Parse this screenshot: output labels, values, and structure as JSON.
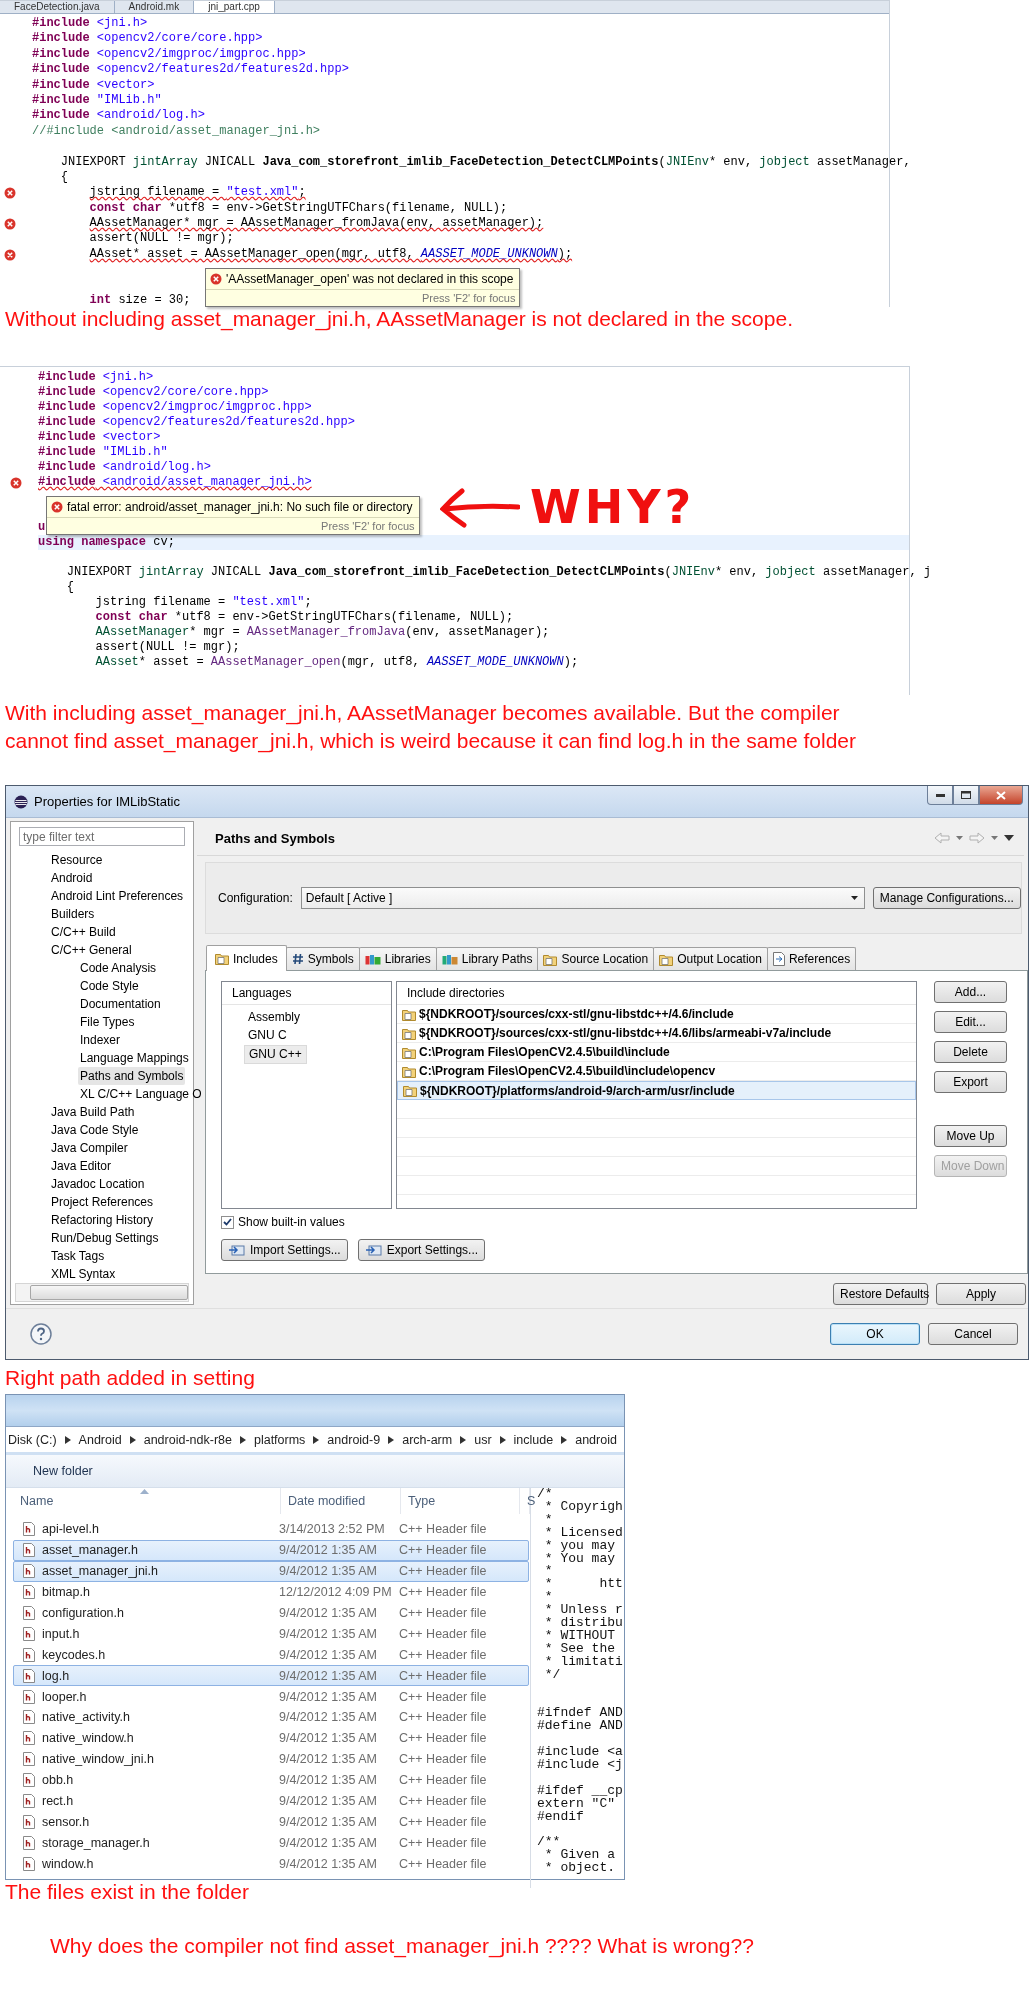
{
  "sections": [
    {
      "kind": "editor",
      "tabs": [
        {
          "label": "FaceDetection.java",
          "selected": false
        },
        {
          "label": "Android.mk",
          "selected": false
        },
        {
          "label": "jni_part.cpp",
          "selected": true
        }
      ],
      "lines": [
        {
          "kind": "code",
          "error": false,
          "current": false,
          "segs": [
            {
              "text": "#include",
              "kind": "kw"
            },
            {
              "text": " <jni.h>",
              "kind": "str"
            }
          ]
        },
        {
          "kind": "code",
          "error": false,
          "current": false,
          "segs": [
            {
              "text": "#include",
              "kind": "kw"
            },
            {
              "text": " <opencv2/core/core.hpp>",
              "kind": "str"
            }
          ]
        },
        {
          "kind": "code",
          "error": false,
          "current": false,
          "segs": [
            {
              "text": "#include",
              "kind": "kw"
            },
            {
              "text": " <opencv2/imgproc/imgproc.hpp>",
              "kind": "str"
            }
          ]
        },
        {
          "kind": "code",
          "error": false,
          "current": false,
          "segs": [
            {
              "text": "#include",
              "kind": "kw"
            },
            {
              "text": " <opencv2/features2d/features2d.hpp>",
              "kind": "str"
            }
          ]
        },
        {
          "kind": "code",
          "error": false,
          "current": false,
          "segs": [
            {
              "text": "#include",
              "kind": "kw"
            },
            {
              "text": " <vector>",
              "kind": "str"
            }
          ]
        },
        {
          "kind": "code",
          "error": false,
          "current": false,
          "segs": [
            {
              "text": "#include",
              "kind": "kw"
            },
            {
              "text": " \"IMLib.h\"",
              "kind": "str"
            }
          ]
        },
        {
          "kind": "code",
          "error": false,
          "current": false,
          "segs": [
            {
              "text": "#include",
              "kind": "kw"
            },
            {
              "text": " <android/log.h>",
              "kind": "str"
            }
          ]
        },
        {
          "kind": "code",
          "error": false,
          "current": false,
          "segs": [
            {
              "text": "//#include <android/asset_manager_jni.h>",
              "kind": "com"
            }
          ]
        },
        {
          "kind": "blank"
        },
        {
          "kind": "code",
          "error": false,
          "current": false,
          "segs": [
            {
              "text": "    JNIEXPORT ",
              "kind": "plain"
            },
            {
              "text": "jintArray",
              "kind": "type"
            },
            {
              "text": " JNICALL ",
              "kind": "plain"
            },
            {
              "text": "Java_com_storefront_imlib_FaceDetection_DetectCLMPoints",
              "kind": "fn"
            },
            {
              "text": "(",
              "kind": "plain"
            },
            {
              "text": "JNIEnv",
              "kind": "type"
            },
            {
              "text": "* env, ",
              "kind": "plain"
            },
            {
              "text": "jobject",
              "kind": "type"
            },
            {
              "text": " assetManager,",
              "kind": "plain"
            }
          ]
        },
        {
          "kind": "code",
          "error": false,
          "current": false,
          "segs": [
            {
              "text": "    {",
              "kind": "plain"
            }
          ]
        },
        {
          "kind": "code",
          "error": true,
          "current": false,
          "segs": [
            {
              "text": "        jstring filename = ",
              "kind": "plain"
            },
            {
              "text": "\"test.xml\"",
              "kind": "str"
            },
            {
              "text": ";",
              "kind": "plain"
            }
          ]
        },
        {
          "kind": "code",
          "error": false,
          "current": false,
          "segs": [
            {
              "text": "        const char",
              "kind": "kw"
            },
            {
              "text": " *utf8 = env->GetStringUTFChars(filename, NULL);",
              "kind": "plain"
            }
          ]
        },
        {
          "kind": "code",
          "error": true,
          "current": false,
          "segs": [
            {
              "text": "        AAssetManager* mgr = AAssetManager_fromJava(env, assetManager);",
              "kind": "plain"
            }
          ]
        },
        {
          "kind": "code",
          "error": false,
          "current": false,
          "segs": [
            {
              "text": "        assert(NULL != mgr);",
              "kind": "plain"
            }
          ]
        },
        {
          "kind": "code",
          "error": true,
          "current": false,
          "segs": [
            {
              "text": "        AAsset* asset = AAssetManager_open(mgr, utf8, ",
              "kind": "plain"
            },
            {
              "text": "AASSET_MODE_UNKNOWN",
              "kind": "mac"
            },
            {
              "text": ");",
              "kind": "plain"
            }
          ]
        },
        {
          "kind": "blank"
        },
        {
          "kind": "blank"
        },
        {
          "kind": "code",
          "error": false,
          "current": false,
          "segs": [
            {
              "text": "        int",
              "kind": "kw"
            },
            {
              "text": " size = 30;",
              "kind": "plain"
            }
          ]
        }
      ],
      "tooltip": {
        "message": "'AAssetManager_open' was not declared in this scope",
        "hint": "Press 'F2' for focus"
      }
    },
    {
      "kind": "caption",
      "lines": [
        "Without including asset_manager_jni.h, AAssetManager is not declared in the scope."
      ]
    },
    {
      "kind": "editor",
      "lines": [
        {
          "kind": "code",
          "error": false,
          "current": false,
          "segs": [
            {
              "text": "#include",
              "kind": "kw"
            },
            {
              "text": " <jni.h>",
              "kind": "str"
            }
          ]
        },
        {
          "kind": "code",
          "error": false,
          "current": false,
          "segs": [
            {
              "text": "#include",
              "kind": "kw"
            },
            {
              "text": " <opencv2/core/core.hpp>",
              "kind": "str"
            }
          ]
        },
        {
          "kind": "code",
          "error": false,
          "current": false,
          "segs": [
            {
              "text": "#include",
              "kind": "kw"
            },
            {
              "text": " <opencv2/imgproc/imgproc.hpp>",
              "kind": "str"
            }
          ]
        },
        {
          "kind": "code",
          "error": false,
          "current": false,
          "segs": [
            {
              "text": "#include",
              "kind": "kw"
            },
            {
              "text": " <opencv2/features2d/features2d.hpp>",
              "kind": "str"
            }
          ]
        },
        {
          "kind": "code",
          "error": false,
          "current": false,
          "segs": [
            {
              "text": "#include",
              "kind": "kw"
            },
            {
              "text": " <vector>",
              "kind": "str"
            }
          ]
        },
        {
          "kind": "code",
          "error": false,
          "current": false,
          "segs": [
            {
              "text": "#include",
              "kind": "kw"
            },
            {
              "text": " \"IMLib.h\"",
              "kind": "str"
            }
          ]
        },
        {
          "kind": "code",
          "error": false,
          "current": false,
          "segs": [
            {
              "text": "#include",
              "kind": "kw"
            },
            {
              "text": " <android/log.h>",
              "kind": "str"
            }
          ]
        },
        {
          "kind": "code",
          "error": true,
          "current": false,
          "segs": [
            {
              "text": "#include",
              "kind": "kw"
            },
            {
              "text": " <android/asset_manager_jni.h>",
              "kind": "str"
            }
          ]
        },
        {
          "kind": "blank"
        },
        {
          "kind": "blank"
        },
        {
          "kind": "code",
          "error": false,
          "current": false,
          "segs": [
            {
              "text": "u",
              "kind": "kw"
            }
          ]
        },
        {
          "kind": "code",
          "error": false,
          "current": true,
          "segs": [
            {
              "text": "using namespace",
              "kind": "kw"
            },
            {
              "text": " cv;",
              "kind": "plain"
            }
          ]
        },
        {
          "kind": "blank"
        },
        {
          "kind": "code",
          "error": false,
          "current": false,
          "segs": [
            {
              "text": "    JNIEXPORT ",
              "kind": "plain"
            },
            {
              "text": "jintArray",
              "kind": "type"
            },
            {
              "text": " JNICALL ",
              "kind": "plain"
            },
            {
              "text": "Java_com_storefront_imlib_FaceDetection_DetectCLMPoints",
              "kind": "fn"
            },
            {
              "text": "(",
              "kind": "plain"
            },
            {
              "text": "JNIEnv",
              "kind": "type"
            },
            {
              "text": "* env, ",
              "kind": "plain"
            },
            {
              "text": "jobject",
              "kind": "type"
            },
            {
              "text": " assetManager, j",
              "kind": "plain"
            }
          ]
        },
        {
          "kind": "code",
          "error": false,
          "current": false,
          "segs": [
            {
              "text": "    {",
              "kind": "plain"
            }
          ]
        },
        {
          "kind": "code",
          "error": false,
          "current": false,
          "segs": [
            {
              "text": "        jstring filename = ",
              "kind": "plain"
            },
            {
              "text": "\"test.xml\"",
              "kind": "str"
            },
            {
              "text": ";",
              "kind": "plain"
            }
          ]
        },
        {
          "kind": "code",
          "error": false,
          "current": false,
          "segs": [
            {
              "text": "        const char",
              "kind": "kw"
            },
            {
              "text": " *utf8 = env->GetStringUTFChars(filename, NULL);",
              "kind": "plain"
            }
          ]
        },
        {
          "kind": "code",
          "error": false,
          "current": false,
          "segs": [
            {
              "text": "        AAssetManager",
              "kind": "type"
            },
            {
              "text": "* mgr = ",
              "kind": "plain"
            },
            {
              "text": "AAssetManager_fromJava",
              "kind": "call"
            },
            {
              "text": "(env, assetManager);",
              "kind": "plain"
            }
          ]
        },
        {
          "kind": "code",
          "error": false,
          "current": false,
          "segs": [
            {
              "text": "        assert(NULL != mgr);",
              "kind": "plain"
            }
          ]
        },
        {
          "kind": "code",
          "error": false,
          "current": false,
          "segs": [
            {
              "text": "        AAsset",
              "kind": "type"
            },
            {
              "text": "* asset = ",
              "kind": "plain"
            },
            {
              "text": "AAssetManager_open",
              "kind": "call"
            },
            {
              "text": "(mgr, utf8, ",
              "kind": "plain"
            },
            {
              "text": "AASSET_MODE_UNKNOWN",
              "kind": "mac"
            },
            {
              "text": ");",
              "kind": "plain"
            }
          ]
        },
        {
          "kind": "blank"
        }
      ],
      "tooltip": {
        "message": "fatal error: android/asset_manager_jni.h: No such file or directory",
        "hint": "Press 'F2' for focus"
      },
      "annotation": {
        "text": "WHY?"
      }
    },
    {
      "kind": "caption",
      "lines": [
        "With including asset_manager_jni.h, AAssetManager becomes available. But the compiler",
        "cannot find asset_manager_jni.h, which is weird because it can find log.h in the same folder"
      ]
    },
    {
      "kind": "dialog",
      "title": "Properties for IMLibStatic",
      "filter": {
        "placeholder": "type filter text"
      },
      "tree": [
        {
          "label": "Resource",
          "selected": false
        },
        {
          "label": "Android",
          "selected": false
        },
        {
          "label": "Android Lint Preferences",
          "selected": false
        },
        {
          "label": "Builders",
          "selected": false
        },
        {
          "label": "C/C++ Build",
          "selected": false
        },
        {
          "label": "C/C++ General",
          "selected": false,
          "children": [
            {
              "label": "Code Analysis",
              "selected": false
            },
            {
              "label": "Code Style",
              "selected": false
            },
            {
              "label": "Documentation",
              "selected": false
            },
            {
              "label": "File Types",
              "selected": false
            },
            {
              "label": "Indexer",
              "selected": false
            },
            {
              "label": "Language Mappings",
              "selected": false
            },
            {
              "label": "Paths and Symbols",
              "selected": true
            },
            {
              "label": "XL C/C++ Language O",
              "selected": false
            }
          ]
        },
        {
          "label": "Java Build Path",
          "selected": false
        },
        {
          "label": "Java Code Style",
          "selected": false
        },
        {
          "label": "Java Compiler",
          "selected": false
        },
        {
          "label": "Java Editor",
          "selected": false
        },
        {
          "label": "Javadoc Location",
          "selected": false
        },
        {
          "label": "Project References",
          "selected": false
        },
        {
          "label": "Refactoring History",
          "selected": false
        },
        {
          "label": "Run/Debug Settings",
          "selected": false
        },
        {
          "label": "Task Tags",
          "selected": false
        },
        {
          "label": "XML Syntax",
          "selected": false
        }
      ],
      "page_title": "Paths and Symbols",
      "configuration": {
        "label": "Configuration:",
        "value": "Default  [ Active ]",
        "button": "Manage Configurations..."
      },
      "tabs": [
        {
          "label": "Includes",
          "selected": true
        },
        {
          "label": "Symbols",
          "selected": false
        },
        {
          "label": "Libraries",
          "selected": false
        },
        {
          "label": "Library Paths",
          "selected": false
        },
        {
          "label": "Source Location",
          "selected": false
        },
        {
          "label": "Output Location",
          "selected": false
        },
        {
          "label": "References",
          "selected": false
        }
      ],
      "languages": {
        "header": "Languages",
        "items": [
          {
            "label": "Assembly",
            "selected": false
          },
          {
            "label": "GNU C",
            "selected": false
          },
          {
            "label": "GNU C++",
            "selected": true
          }
        ]
      },
      "directories": {
        "header": "Include directories",
        "items": [
          {
            "path": "${NDKROOT}/sources/cxx-stl/gnu-libstdc++/4.6/include",
            "selected": false
          },
          {
            "path": "${NDKROOT}/sources/cxx-stl/gnu-libstdc++/4.6/libs/armeabi-v7a/include",
            "selected": false
          },
          {
            "path": "C:\\Program Files\\OpenCV2.4.5\\build\\include",
            "selected": false
          },
          {
            "path": "C:\\Program Files\\OpenCV2.4.5\\build\\include\\opencv",
            "selected": false
          },
          {
            "path": "${NDKROOT}/platforms/android-9/arch-arm/usr/include",
            "selected": true
          }
        ]
      },
      "edit_buttons": [
        {
          "label": "Add...",
          "disabled": false
        },
        {
          "label": "Edit...",
          "disabled": false
        },
        {
          "label": "Delete",
          "disabled": false
        },
        {
          "label": "Export",
          "disabled": false
        }
      ],
      "order_buttons": [
        {
          "label": "Move Up",
          "disabled": false
        },
        {
          "label": "Move Down",
          "disabled": true
        }
      ],
      "show_builtin": {
        "label": "Show built-in values",
        "checked": true
      },
      "settings_buttons": [
        "Import Settings...",
        "Export Settings..."
      ],
      "page_buttons": [
        "Restore Defaults",
        "Apply"
      ],
      "footer_buttons": [
        {
          "label": "OK",
          "default": true
        },
        {
          "label": "Cancel",
          "default": false
        }
      ]
    },
    {
      "kind": "caption",
      "lines": [
        "Right path added in setting"
      ]
    },
    {
      "kind": "explorer",
      "breadcrumb": [
        "Disk (C:)",
        "Android",
        "android-ndk-r8e",
        "platforms",
        "android-9",
        "arch-arm",
        "usr",
        "include",
        "android"
      ],
      "toolbar": [
        "New folder"
      ],
      "columns": [
        "Name",
        "Date modified",
        "Type",
        "S"
      ],
      "files": [
        {
          "name": "api-level.h",
          "date": "3/14/2013 2:52 PM",
          "type": "C++ Header file",
          "selected": false
        },
        {
          "name": "asset_manager.h",
          "date": "9/4/2012 1:35 AM",
          "type": "C++ Header file",
          "selected": true
        },
        {
          "name": "asset_manager_jni.h",
          "date": "9/4/2012 1:35 AM",
          "type": "C++ Header file",
          "selected": true
        },
        {
          "name": "bitmap.h",
          "date": "12/12/2012 4:09 PM",
          "type": "C++ Header file",
          "selected": false
        },
        {
          "name": "configuration.h",
          "date": "9/4/2012 1:35 AM",
          "type": "C++ Header file",
          "selected": false
        },
        {
          "name": "input.h",
          "date": "9/4/2012 1:35 AM",
          "type": "C++ Header file",
          "selected": false
        },
        {
          "name": "keycodes.h",
          "date": "9/4/2012 1:35 AM",
          "type": "C++ Header file",
          "selected": false
        },
        {
          "name": "log.h",
          "date": "9/4/2012 1:35 AM",
          "type": "C++ Header file",
          "selected": true
        },
        {
          "name": "looper.h",
          "date": "9/4/2012 1:35 AM",
          "type": "C++ Header file",
          "selected": false
        },
        {
          "name": "native_activity.h",
          "date": "9/4/2012 1:35 AM",
          "type": "C++ Header file",
          "selected": false
        },
        {
          "name": "native_window.h",
          "date": "9/4/2012 1:35 AM",
          "type": "C++ Header file",
          "selected": false
        },
        {
          "name": "native_window_jni.h",
          "date": "9/4/2012 1:35 AM",
          "type": "C++ Header file",
          "selected": false
        },
        {
          "name": "obb.h",
          "date": "9/4/2012 1:35 AM",
          "type": "C++ Header file",
          "selected": false
        },
        {
          "name": "rect.h",
          "date": "9/4/2012 1:35 AM",
          "type": "C++ Header file",
          "selected": false
        },
        {
          "name": "sensor.h",
          "date": "9/4/2012 1:35 AM",
          "type": "C++ Header file",
          "selected": false
        },
        {
          "name": "storage_manager.h",
          "date": "9/4/2012 1:35 AM",
          "type": "C++ Header file",
          "selected": false
        },
        {
          "name": "window.h",
          "date": "9/4/2012 1:35 AM",
          "type": "C++ Header file",
          "selected": false
        }
      ],
      "preview": [
        [
          "/*",
          " * Copyrigh",
          " *",
          " * Licensed",
          " * you may",
          " * You may",
          " *",
          " *      htt",
          " *",
          " * Unless r",
          " * distribu",
          " * WITHOUT",
          " * See the",
          " * limitati",
          " */"
        ],
        [
          "#ifndef AND",
          "#define AND"
        ],
        [
          "#include <a",
          "#include <j"
        ],
        [
          "#ifdef __cp",
          "extern \"C\"",
          "#endif"
        ],
        [
          "/**",
          " * Given a",
          " * object."
        ]
      ]
    },
    {
      "kind": "caption",
      "lines": [
        "The files exist in the folder"
      ]
    },
    {
      "kind": "question",
      "lines": [
        "Why does the compiler not find asset_manager_jni.h ???? What is wrong??"
      ]
    }
  ]
}
